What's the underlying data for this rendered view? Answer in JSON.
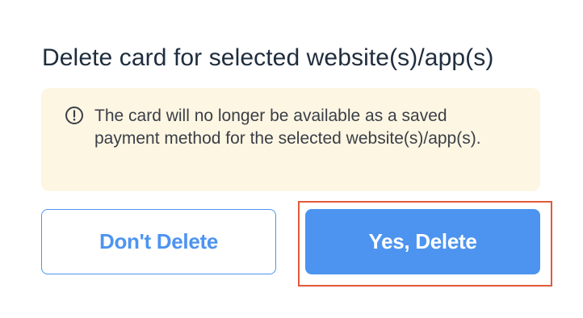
{
  "dialog": {
    "title": "Delete card for selected website(s)/app(s)",
    "warning": {
      "icon": "exclamation-circle-icon",
      "text": "The card will no longer be available as a saved payment method for the selected website(s)/app(s)."
    },
    "buttons": {
      "cancel_label": "Don't Delete",
      "confirm_label": "Yes, Delete"
    }
  },
  "colors": {
    "accent": "#4d94f0",
    "warning_background": "#fdf6e3",
    "title_text": "#1f2d3d",
    "highlight_outline": "#e05a3a"
  }
}
